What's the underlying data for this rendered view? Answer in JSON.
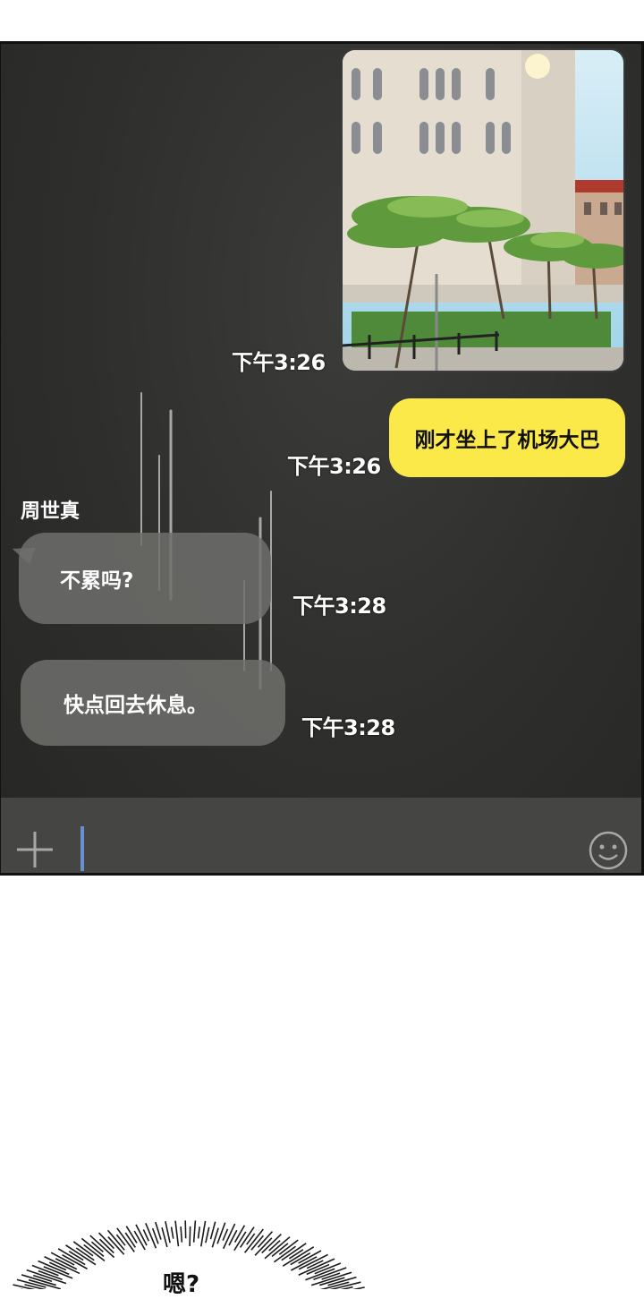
{
  "chat": {
    "messages": [
      {
        "type": "image",
        "direction": "outgoing",
        "description": "",
        "time": "下午3:26"
      },
      {
        "type": "text",
        "direction": "outgoing",
        "text": "刚才坐上了机场大巴",
        "time": "下午3:26"
      },
      {
        "type": "text",
        "direction": "incoming",
        "sender": "周世真",
        "text": "不累吗?",
        "time": "下午3:28"
      },
      {
        "type": "text",
        "direction": "incoming",
        "text": "快点回去休息。",
        "time": "下午3:28"
      }
    ],
    "input": {
      "value": ""
    }
  },
  "reaction": {
    "text": "嗯?"
  },
  "icons": {
    "add": "plus-icon",
    "emoji": "smile-icon"
  },
  "colors": {
    "outgoing_bubble": "#fbe94a",
    "incoming_bubble": "#6e6e6c",
    "chat_bg": "#2e2e2c",
    "cursor": "#6a8fd0"
  }
}
